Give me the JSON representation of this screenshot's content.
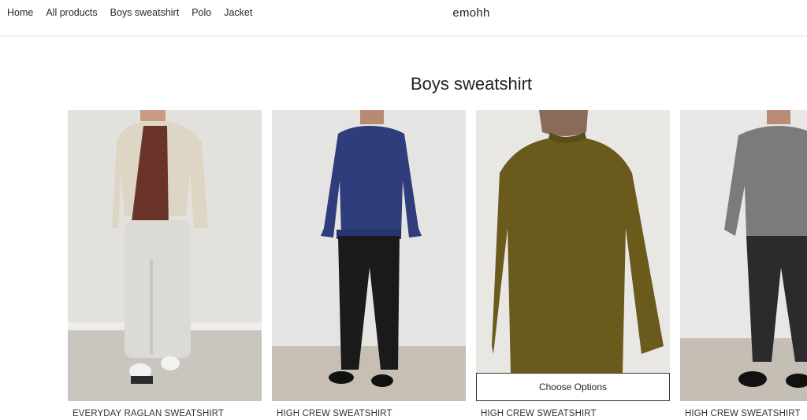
{
  "header": {
    "nav": [
      "Home",
      "All products",
      "Boys sweatshirt",
      "Polo",
      "Jacket"
    ],
    "brand": "emohh"
  },
  "collection": {
    "title": "Boys sweatshirt"
  },
  "products": [
    {
      "name": "EVERYDAY RAGLAN SWEATSHIRT",
      "image": "model-cream-jacket-image"
    },
    {
      "name": "HIGH CREW SWEATSHIRT",
      "image": "model-navy-sweatshirt-image"
    },
    {
      "name": "HIGH CREW SWEATSHIRT",
      "image": "model-olive-sweatshirt-image",
      "button": "Choose Options"
    },
    {
      "name": "HIGH CREW SWEATSHIRT",
      "image": "model-grey-sweatshirt-image"
    }
  ],
  "colors": {
    "navy": "#2f3d7c",
    "olive": "#6a5a1c",
    "grey": "#7b7b7d",
    "cream": "#e2dccd"
  }
}
